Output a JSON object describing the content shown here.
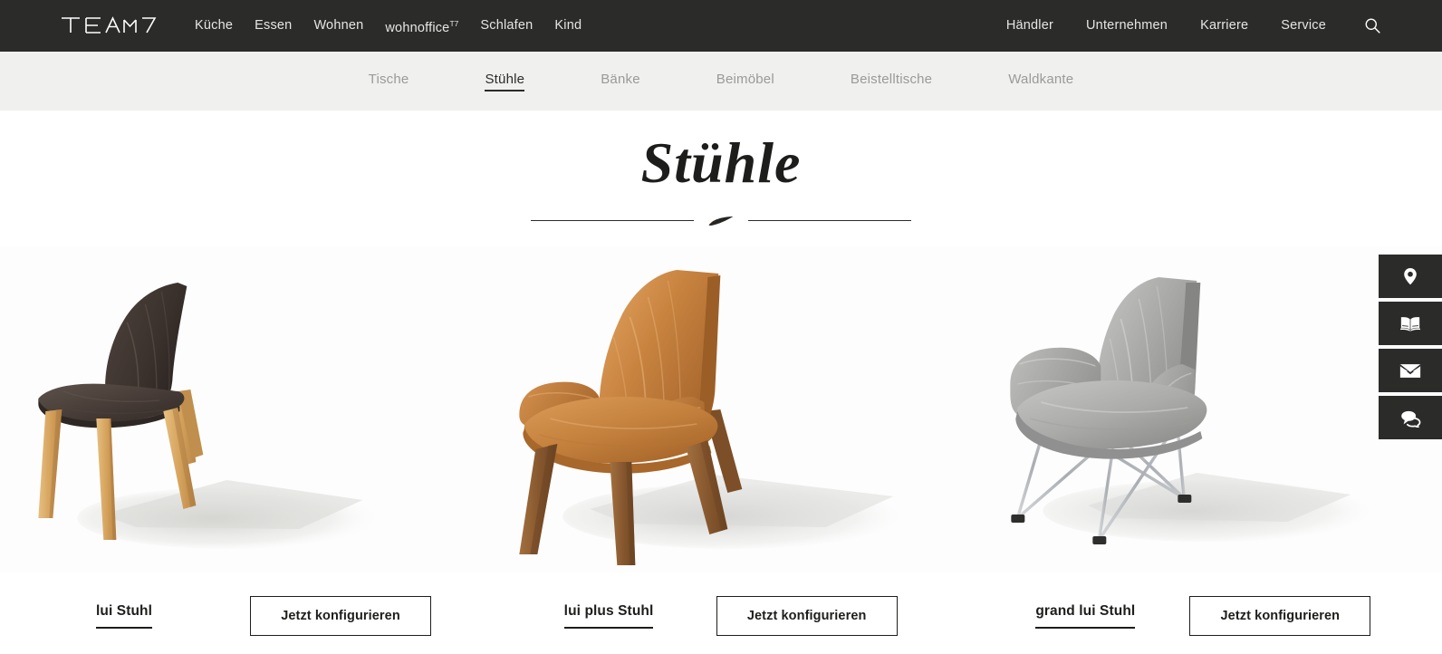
{
  "brand": {
    "logo_text": "TEAM7",
    "logo_name": "team7-logo"
  },
  "header": {
    "background": "#2b2b2a",
    "main_nav": [
      {
        "label": "Küche",
        "sup": ""
      },
      {
        "label": "Essen",
        "sup": ""
      },
      {
        "label": "Wohnen",
        "sup": ""
      },
      {
        "label": "wohnoffice",
        "sup": "T7"
      },
      {
        "label": "Schlafen",
        "sup": ""
      },
      {
        "label": "Kind",
        "sup": ""
      }
    ],
    "right_nav": [
      {
        "label": "Händler"
      },
      {
        "label": "Unternehmen"
      },
      {
        "label": "Karriere"
      },
      {
        "label": "Service"
      }
    ],
    "search_icon": "search-icon"
  },
  "subnav": {
    "background": "#f0f0ef",
    "active_index": 1,
    "items": [
      {
        "label": "Tische"
      },
      {
        "label": "Stühle"
      },
      {
        "label": "Bänke"
      },
      {
        "label": "Beimöbel"
      },
      {
        "label": "Beistelltische"
      },
      {
        "label": "Waldkante"
      }
    ]
  },
  "main": {
    "title": "Stühle",
    "divider_ornament": "leaf-ornament"
  },
  "products": [
    {
      "name": "lui Stuhl",
      "button_label": "Jetzt konfigurieren",
      "image_alt": "lui-stuhl-chair-image",
      "colors": {
        "upholstery": "#463c38",
        "upholstery_light": "#5d524c",
        "legs": "#d9a861"
      }
    },
    {
      "name": "lui plus Stuhl",
      "button_label": "Jetzt konfigurieren",
      "image_alt": "lui-plus-stuhl-chair-image",
      "colors": {
        "upholstery": "#c37f3f",
        "upholstery_light": "#d99a5c",
        "legs": "#8a5a33"
      }
    },
    {
      "name": "grand lui Stuhl",
      "button_label": "Jetzt konfigurieren",
      "image_alt": "grand-lui-stuhl-chair-image",
      "colors": {
        "upholstery": "#9a9a98",
        "upholstery_light": "#b5b5b3",
        "legs": "#b9bcc0"
      }
    }
  ],
  "side_tabs": [
    {
      "icon": "location-pin-icon"
    },
    {
      "icon": "catalog-book-icon"
    },
    {
      "icon": "envelope-mail-icon"
    },
    {
      "icon": "chat-bubbles-icon"
    }
  ]
}
